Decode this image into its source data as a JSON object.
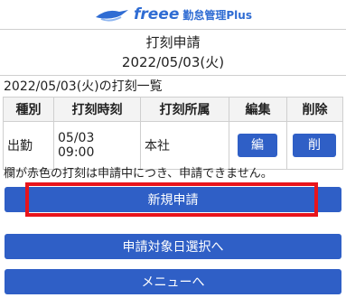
{
  "app": {
    "logo_text": "freee",
    "logo_sub": "勤怠管理Plus",
    "accent_color": "#2f5fc6",
    "highlight_color": "#e8141b"
  },
  "header": {
    "title": "打刻申請",
    "date": "2022/05/03(火)"
  },
  "list": {
    "title": "2022/05/03(火)の打刻一覧",
    "columns": [
      "種別",
      "打刻時刻",
      "打刻所属",
      "編集",
      "削除"
    ],
    "rows": [
      {
        "type": "出勤",
        "time_date": "05/03",
        "time_clock": "09:00",
        "department": "本社",
        "edit_label": "編",
        "delete_label": "削"
      }
    ]
  },
  "notice": "欄が赤色の打刻は申請中につき、申請できません。",
  "buttons": {
    "new_request": "新規申請",
    "select_date": "申請対象日選択へ",
    "menu": "メニューへ"
  }
}
